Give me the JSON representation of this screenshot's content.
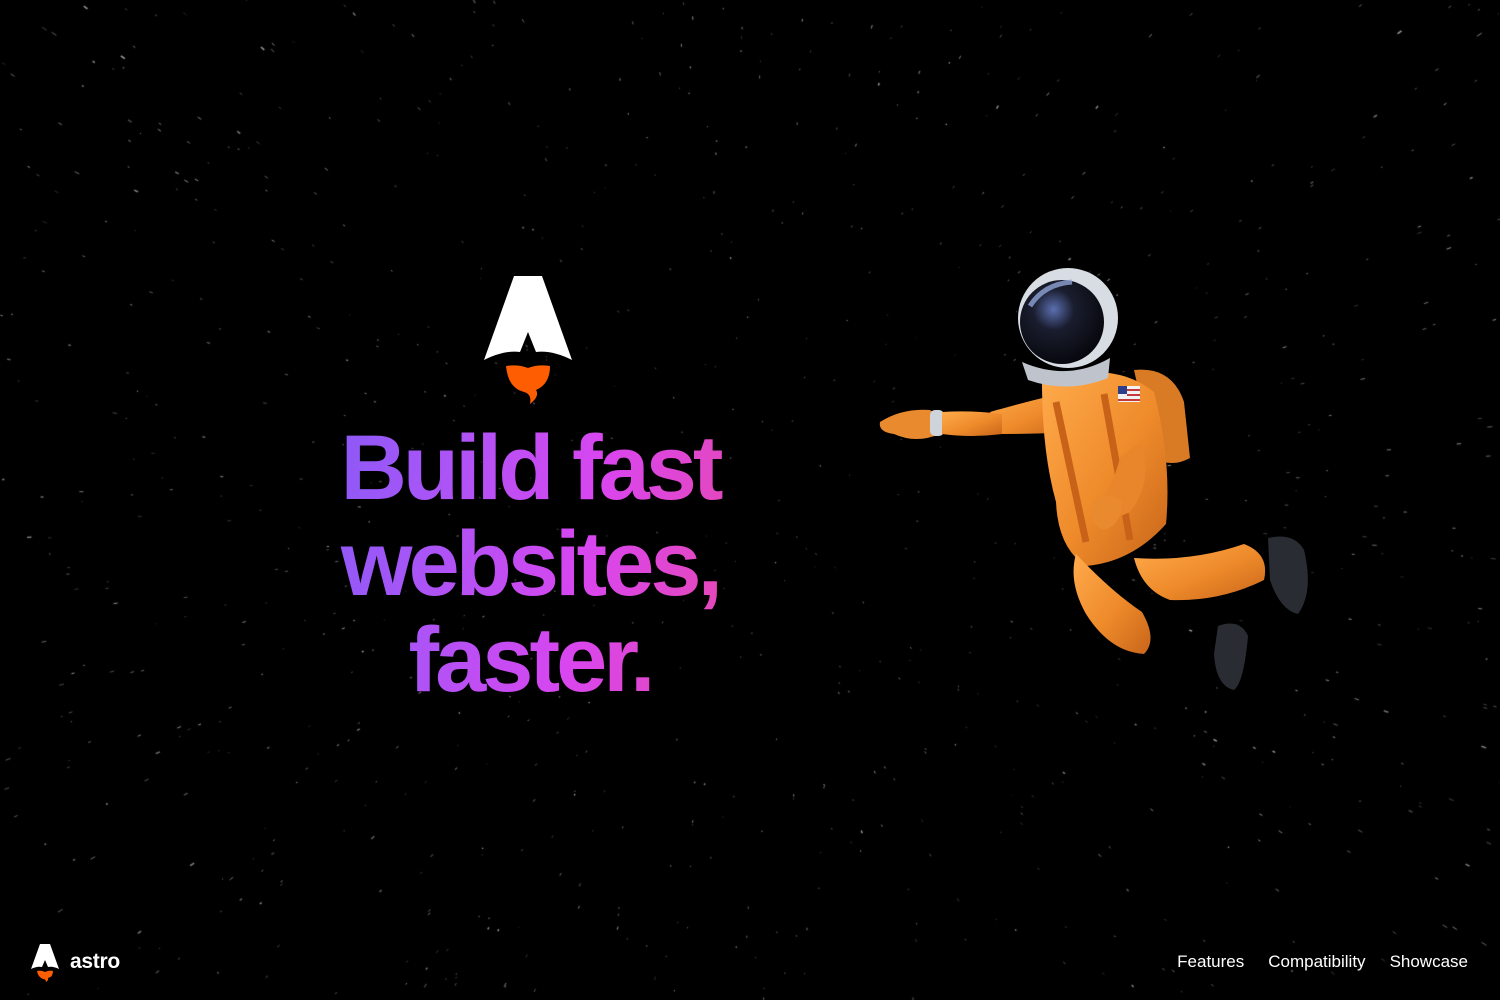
{
  "hero": {
    "logo_icon": "astro-rocket-logo-icon",
    "headline_lines": [
      "Build fast",
      "websites,",
      "faster."
    ],
    "gradient": [
      "#7a5cf6",
      "#a855f7",
      "#d946ef",
      "#ec4899"
    ],
    "illustration": "floating-astronaut-illustration"
  },
  "footer": {
    "brand_icon": "astro-logo-icon",
    "brand_label": "astro",
    "nav": [
      {
        "label": "Features"
      },
      {
        "label": "Compatibility"
      },
      {
        "label": "Showcase"
      }
    ]
  },
  "colors": {
    "background": "#000000",
    "logo_white": "#ffffff",
    "flame_orange": "#ff5d01",
    "suit_orange": "#f08a24"
  }
}
